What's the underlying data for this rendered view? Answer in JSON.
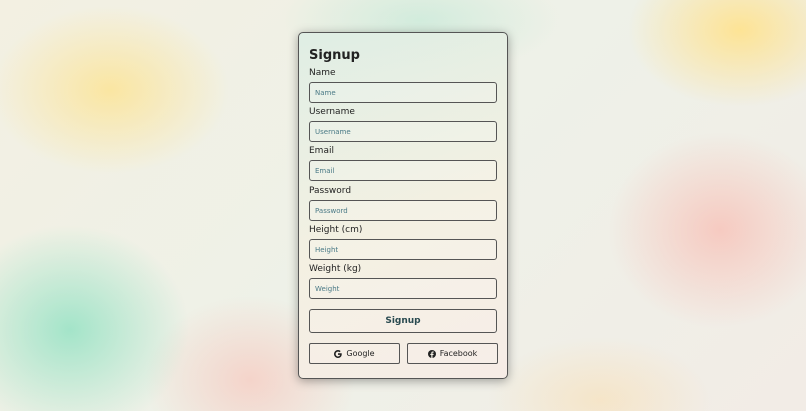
{
  "form": {
    "title": "Signup",
    "fields": [
      {
        "label": "Name",
        "placeholder": "Name",
        "value": ""
      },
      {
        "label": "Username",
        "placeholder": "Username",
        "value": ""
      },
      {
        "label": "Email",
        "placeholder": "Email",
        "value": ""
      },
      {
        "label": "Password",
        "placeholder": "Password",
        "value": ""
      },
      {
        "label": "Height (cm)",
        "placeholder": "Height",
        "value": ""
      },
      {
        "label": "Weight (kg)",
        "placeholder": "Weight",
        "value": ""
      }
    ],
    "submit_label": "Signup"
  },
  "social": {
    "google": {
      "label": "Google",
      "icon": "google-icon"
    },
    "facebook": {
      "label": "Facebook",
      "icon": "facebook-icon"
    }
  },
  "colors": {
    "border": "#555555",
    "placeholder": "#4a7a86",
    "text": "#222222"
  }
}
